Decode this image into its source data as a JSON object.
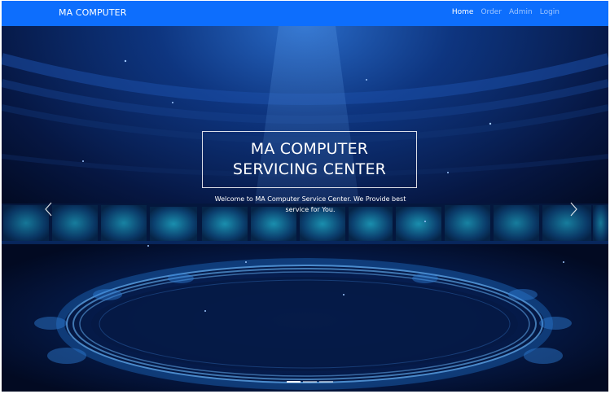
{
  "navbar": {
    "brand": "MA COMPUTER",
    "links": [
      {
        "label": "Home",
        "active": true
      },
      {
        "label": "Order",
        "active": false
      },
      {
        "label": "Admin",
        "active": false
      },
      {
        "label": "Login",
        "active": false
      }
    ],
    "color": "#0d6efd"
  },
  "hero": {
    "title_line1": "MA COMPUTER",
    "title_line2": "SERVICING CENTER",
    "subtitle_line1": "Welcome to MA Computer Service Center. We Provide best",
    "subtitle_line2": "service for You.",
    "prev_icon": "chevron-left-icon",
    "next_icon": "chevron-right-icon",
    "slides": 3,
    "active_slide": 1
  }
}
